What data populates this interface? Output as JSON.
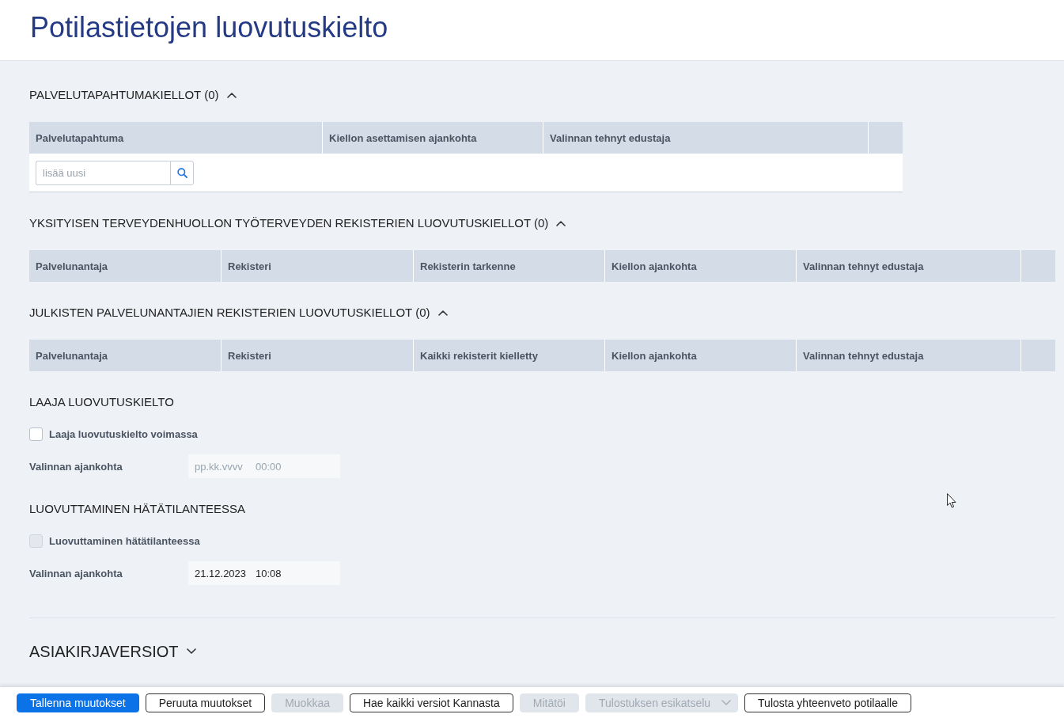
{
  "title": "Potilastietojen luovutuskielto",
  "sections": [
    {
      "kind": "table",
      "heading": "PALVELUTAPAHTUMAKIELLOT (0)",
      "expanded": true,
      "columns": [
        "Palvelutapahtuma",
        "Kiellon asettamisen ajankohta",
        "Valinnan tehnyt edustaja"
      ],
      "add_field": {
        "placeholder": "lisää uusi"
      }
    },
    {
      "kind": "table",
      "heading": "YKSITYISEN TERVEYDENHUOLLON TYÖTERVEYDEN REKISTERIEN LUOVUTUSKIELLOT (0)",
      "expanded": true,
      "columns": [
        "Palvelunantaja",
        "Rekisteri",
        "Rekisterin tarkenne",
        "Kiellon ajankohta",
        "Valinnan tehnyt edustaja"
      ]
    },
    {
      "kind": "table",
      "heading": "JULKISTEN PALVELUNANTAJIEN REKISTERIEN LUOVUTUSKIELLOT (0)",
      "expanded": true,
      "columns": [
        "Palvelunantaja",
        "Rekisteri",
        "Kaikki rekisterit kielletty",
        "Kiellon ajankohta",
        "Valinnan tehnyt edustaja"
      ]
    },
    {
      "kind": "option",
      "heading": "LAAJA LUOVUTUSKIELTO",
      "checkbox": {
        "label": "Laaja luovutuskielto voimassa",
        "checked": false,
        "disabled": false
      },
      "time_field": {
        "label": "Valinnan ajankohta",
        "date": {
          "placeholder": "pp.kk.vvvv"
        },
        "time": {
          "placeholder": "00:00"
        }
      }
    },
    {
      "kind": "option",
      "heading": "LUOVUTTAMINEN HÄTÄTILANTEESSA",
      "checkbox": {
        "label": "Luovuttaminen hätätilanteessa",
        "checked": false,
        "disabled": true
      },
      "time_field": {
        "label": "Valinnan ajankohta",
        "date": {
          "value": "21.12.2023"
        },
        "time": {
          "value": "10:08"
        }
      }
    },
    {
      "kind": "collapsible",
      "heading": "ASIAKIRJAVERSIOT",
      "expanded": false
    }
  ],
  "actions": [
    {
      "label": "Tallenna muutokset",
      "kind": "primary",
      "disabled": false
    },
    {
      "label": "Peruuta muutokset",
      "kind": "outline",
      "disabled": false
    },
    {
      "label": "Muokkaa",
      "kind": "outline",
      "disabled": true
    },
    {
      "label": "Hae kaikki versiot Kannasta",
      "kind": "outline",
      "disabled": false
    },
    {
      "label": "Mitätöi",
      "kind": "outline",
      "disabled": true
    },
    {
      "label": "Tulostuksen esikatselu",
      "kind": "dropdown",
      "disabled": true
    },
    {
      "label": "Tulosta yhteenveto potilaalle",
      "kind": "outline",
      "disabled": false
    }
  ]
}
